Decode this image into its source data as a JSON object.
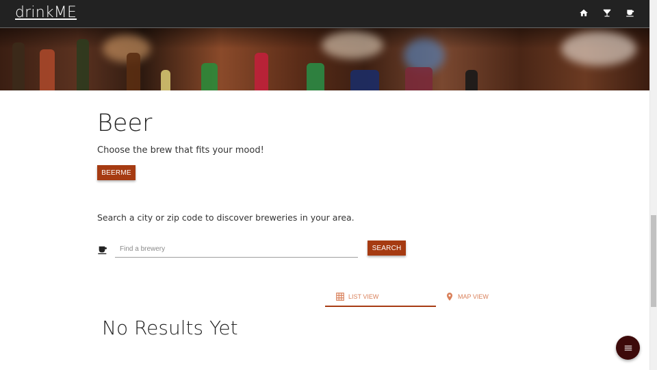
{
  "navbar": {
    "brand": "drinkME",
    "icons": [
      "home-icon",
      "cocktail-icon",
      "coffee-icon"
    ]
  },
  "hero": {
    "image": "bar-shelf-bottles-photo"
  },
  "main": {
    "title": "Beer",
    "subtitle": "Choose the brew that fits your mood!",
    "beerme_label": "BEERME",
    "search_description": "Search a city or zip code to discover breweries in your area.",
    "search_placeholder": "Find a brewery",
    "search_value": "",
    "search_label": "SEARCH"
  },
  "tabs": [
    {
      "label": "LIST VIEW",
      "icon": "grid-icon",
      "active": true
    },
    {
      "label": "MAP VIEW",
      "icon": "map-pin-icon",
      "active": false
    }
  ],
  "results": {
    "empty_text": "No Results Yet"
  },
  "fab": {
    "icon": "menu-icon"
  },
  "colors": {
    "navbar": "#222222",
    "accent": "#a63b12",
    "tab_text": "#d9805a",
    "fab": "#3d0a0a"
  }
}
